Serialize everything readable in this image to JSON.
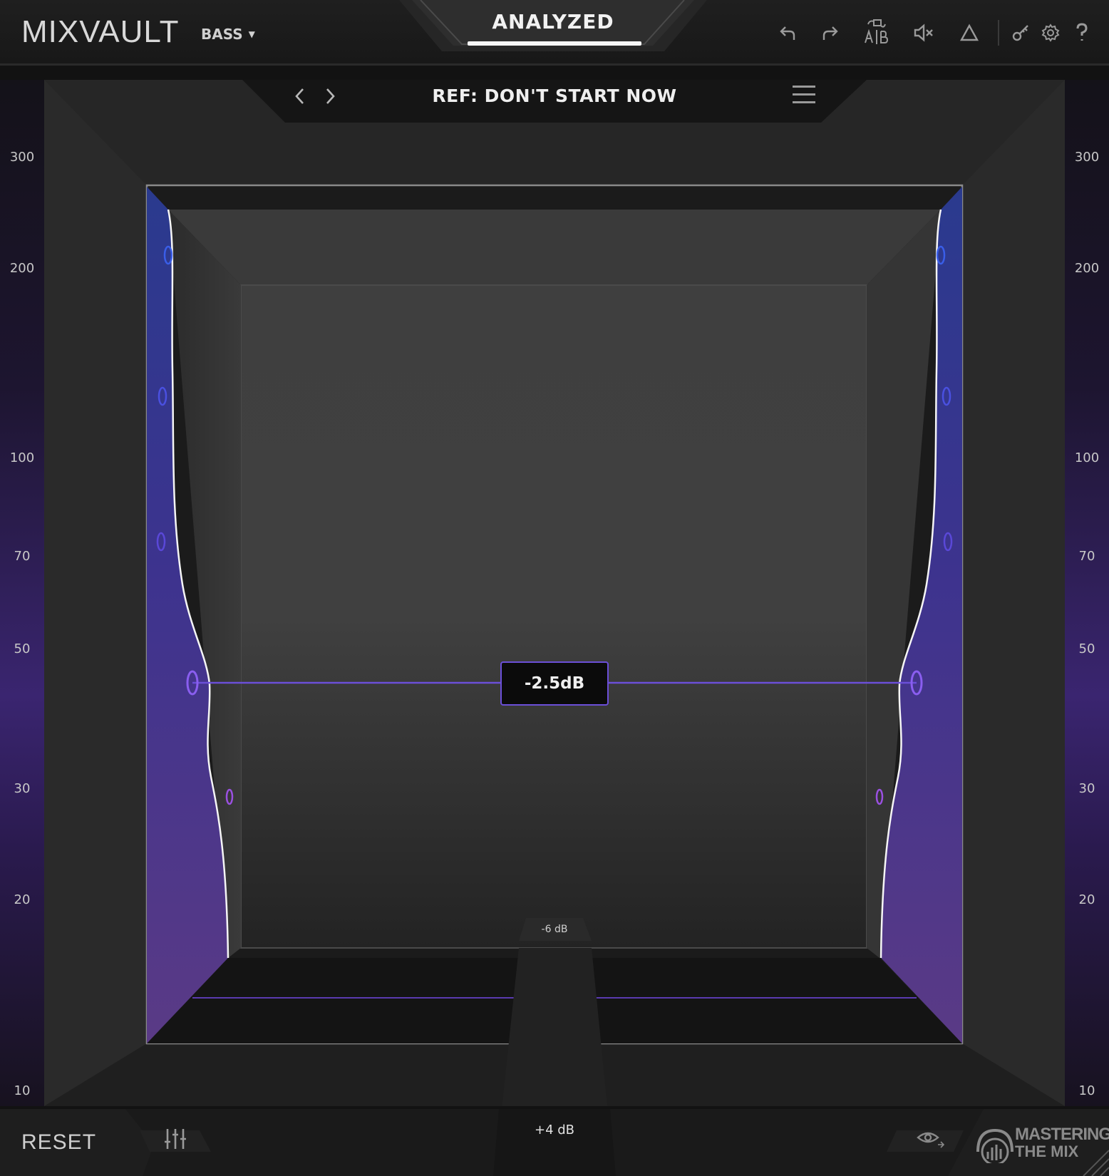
{
  "header": {
    "logo": "MIXVAULT",
    "preset": "BASS",
    "mode_tab": "ANALYZED"
  },
  "reference": {
    "title": "REF: DON'T START NOW"
  },
  "ruler": {
    "ticks": [
      "300",
      "200",
      "100",
      "70",
      "50",
      "30",
      "20",
      "10"
    ]
  },
  "room": {
    "selected_value": "-2.5dB",
    "floor_level": "-6 dB",
    "bottom_level": "+4 dB"
  },
  "footer": {
    "reset_label": "RESET",
    "brand_line1": "MASTERING",
    "brand_line2": "THE MIX"
  },
  "colors": {
    "accent": "#6b4fd8",
    "wall_top": "#2a3a8a",
    "wall_bottom": "#5a3a86"
  },
  "icons": [
    "undo-icon",
    "redo-icon",
    "ab-compare-icon",
    "mute-icon",
    "delta-icon",
    "key-icon",
    "gear-icon",
    "help-icon",
    "chevron-left-icon",
    "chevron-right-icon",
    "menu-icon",
    "sliders-icon",
    "eye-icon"
  ]
}
